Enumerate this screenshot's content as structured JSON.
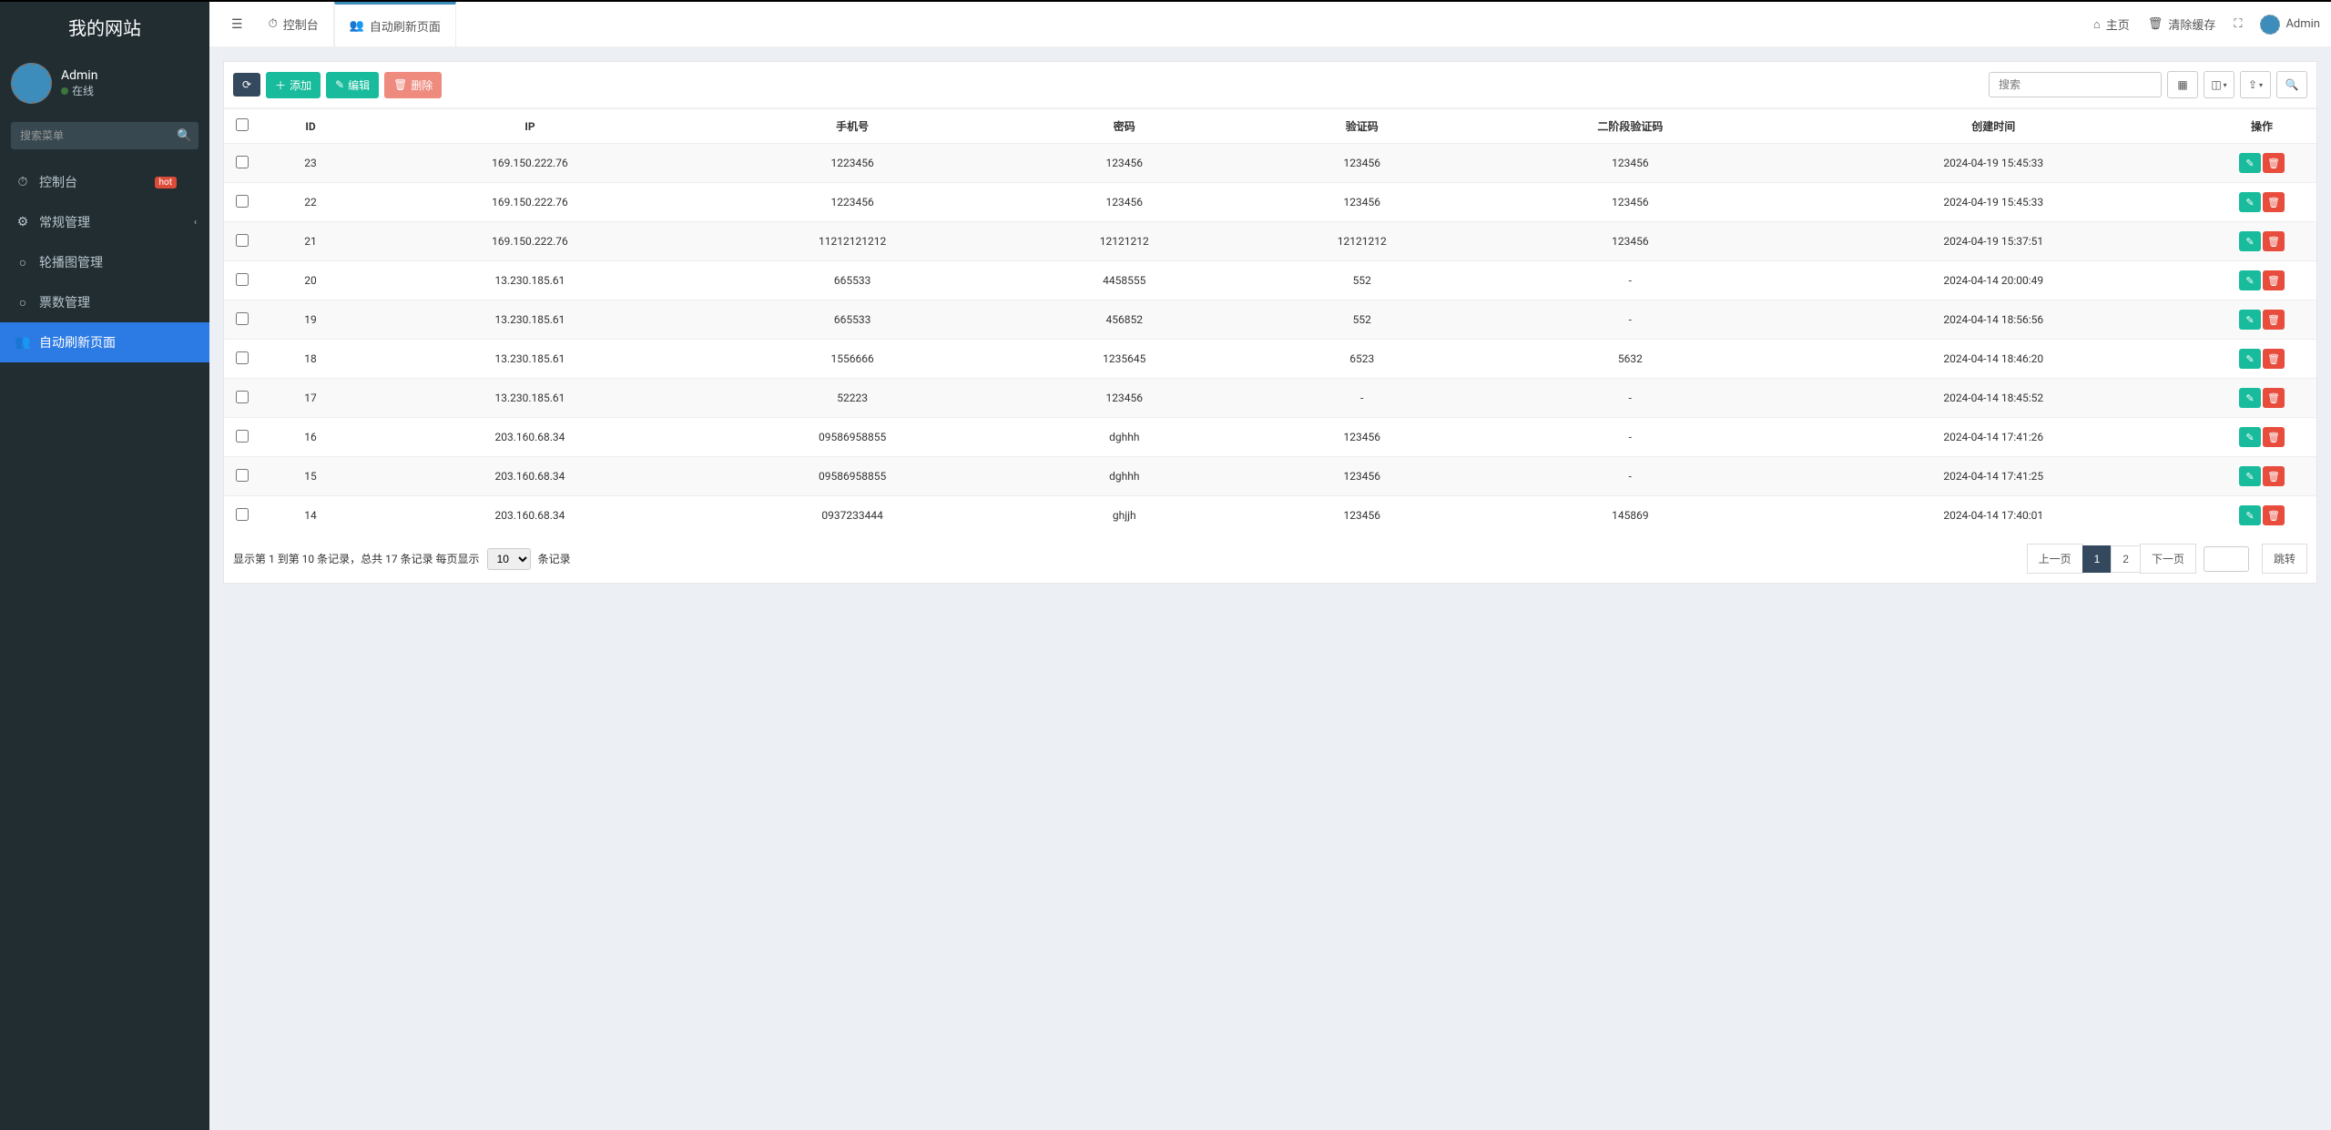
{
  "site_title": "我的网站",
  "user": {
    "name": "Admin",
    "status": "在线"
  },
  "sidebar": {
    "search_placeholder": "搜索菜单",
    "items": [
      {
        "icon": "dashboard",
        "label": "控制台",
        "badge": "hot"
      },
      {
        "icon": "cogs",
        "label": "常规管理",
        "caret": true
      },
      {
        "icon": "circle",
        "label": "轮播图管理"
      },
      {
        "icon": "circle",
        "label": "票数管理"
      },
      {
        "icon": "users",
        "label": "自动刷新页面",
        "active": true
      }
    ]
  },
  "topbar": {
    "tabs": [
      {
        "icon": "dashboard",
        "label": "控制台"
      },
      {
        "icon": "users",
        "label": "自动刷新页面",
        "active": true
      }
    ],
    "right": {
      "home": "主页",
      "clear_cache": "清除缓存",
      "user": "Admin"
    }
  },
  "toolbar": {
    "refresh": "",
    "add": "添加",
    "edit": "编辑",
    "delete": "删除",
    "search_placeholder": "搜索"
  },
  "table": {
    "headers": [
      "",
      "ID",
      "IP",
      "手机号",
      "密码",
      "验证码",
      "二阶段验证码",
      "创建时间",
      "操作"
    ],
    "rows": [
      {
        "id": "23",
        "ip": "169.150.222.76",
        "phone": "1223456",
        "pwd": "123456",
        "vcode": "123456",
        "v2": "123456",
        "ct": "2024-04-19 15:45:33"
      },
      {
        "id": "22",
        "ip": "169.150.222.76",
        "phone": "1223456",
        "pwd": "123456",
        "vcode": "123456",
        "v2": "123456",
        "ct": "2024-04-19 15:45:33"
      },
      {
        "id": "21",
        "ip": "169.150.222.76",
        "phone": "11212121212",
        "pwd": "12121212",
        "vcode": "12121212",
        "v2": "123456",
        "ct": "2024-04-19 15:37:51"
      },
      {
        "id": "20",
        "ip": "13.230.185.61",
        "phone": "665533",
        "pwd": "4458555",
        "vcode": "552",
        "v2": "-",
        "ct": "2024-04-14 20:00:49"
      },
      {
        "id": "19",
        "ip": "13.230.185.61",
        "phone": "665533",
        "pwd": "456852",
        "vcode": "552",
        "v2": "-",
        "ct": "2024-04-14 18:56:56"
      },
      {
        "id": "18",
        "ip": "13.230.185.61",
        "phone": "1556666",
        "pwd": "1235645",
        "vcode": "6523",
        "v2": "5632",
        "ct": "2024-04-14 18:46:20"
      },
      {
        "id": "17",
        "ip": "13.230.185.61",
        "phone": "52223",
        "pwd": "123456",
        "vcode": "-",
        "v2": "-",
        "ct": "2024-04-14 18:45:52"
      },
      {
        "id": "16",
        "ip": "203.160.68.34",
        "phone": "09586958855",
        "pwd": "dghhh",
        "vcode": "123456",
        "v2": "-",
        "ct": "2024-04-14 17:41:26"
      },
      {
        "id": "15",
        "ip": "203.160.68.34",
        "phone": "09586958855",
        "pwd": "dghhh",
        "vcode": "123456",
        "v2": "-",
        "ct": "2024-04-14 17:41:25"
      },
      {
        "id": "14",
        "ip": "203.160.68.34",
        "phone": "0937233444",
        "pwd": "ghjjh",
        "vcode": "123456",
        "v2": "145869",
        "ct": "2024-04-14 17:40:01"
      }
    ]
  },
  "pagination": {
    "info_prefix": "显示第 1 到第 10 条记录，总共 17 条记录 每页显示",
    "page_size": "10",
    "info_suffix": "条记录",
    "prev": "上一页",
    "next": "下一页",
    "jump": "跳转",
    "pages": [
      "1",
      "2"
    ],
    "active": "1"
  },
  "icons": {
    "dashboard": "⏱",
    "cogs": "⚙",
    "circle": "○",
    "users": "👥",
    "home": "⌂",
    "trash": "🗑",
    "expand": "⛶",
    "search": "🔍",
    "bars": "☰",
    "plus": "＋",
    "pencil": "✎",
    "refresh": "⟳",
    "toggle": "▦",
    "columns": "◫",
    "export": "⇪",
    "caret": "‹"
  }
}
